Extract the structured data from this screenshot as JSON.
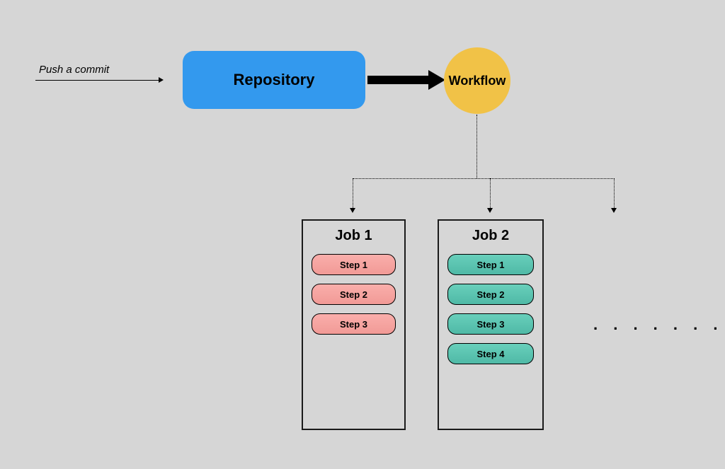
{
  "trigger_label": "Push a commit",
  "repository_label": "Repository",
  "workflow_label": "Workflow",
  "ellipsis": ". . . . . . .",
  "jobs": [
    {
      "title": "Job 1",
      "color": "pink",
      "steps": [
        "Step 1",
        "Step 2",
        "Step 3"
      ]
    },
    {
      "title": "Job 2",
      "color": "teal",
      "steps": [
        "Step 1",
        "Step 2",
        "Step 3",
        "Step 4"
      ]
    }
  ]
}
